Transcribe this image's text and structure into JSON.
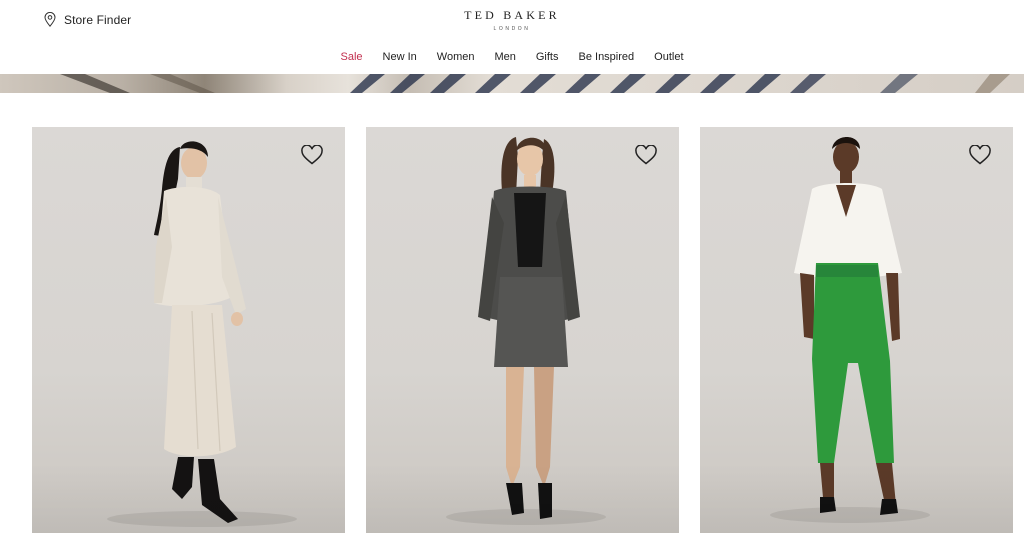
{
  "header": {
    "store_finder": "Store Finder",
    "logo": "TED BAKER",
    "logo_sub": "LONDON"
  },
  "nav": {
    "items": [
      "Sale",
      "New In",
      "Women",
      "Men",
      "Gifts",
      "Be Inspired",
      "Outlet"
    ],
    "sale_color": "#c2304f"
  },
  "icons": {
    "location": "location-pin-icon",
    "wishlist": "heart-outline-icon"
  },
  "products": [
    {
      "image": "model-cream-knit-skirt-set"
    },
    {
      "image": "model-tweed-jacket-skirt"
    },
    {
      "image": "model-white-shirt-green-trousers"
    }
  ]
}
